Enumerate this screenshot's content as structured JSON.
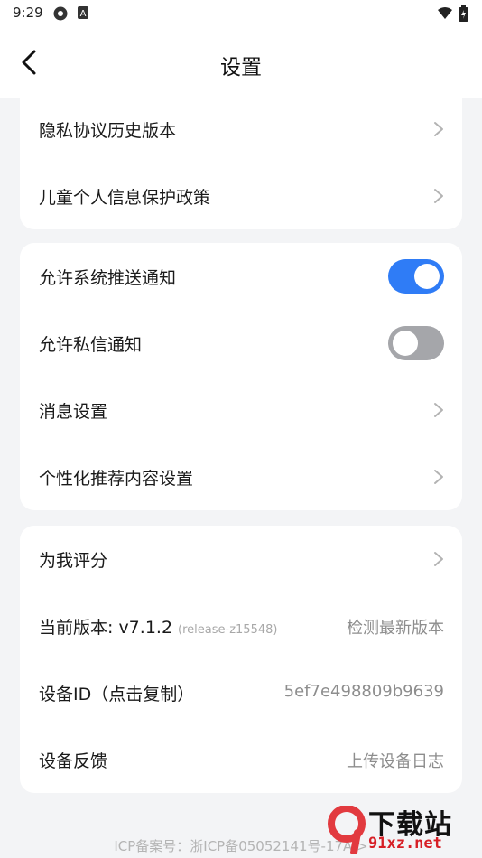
{
  "status_bar": {
    "time": "9:29"
  },
  "header": {
    "title": "设置"
  },
  "card1": {
    "items": [
      {
        "label": "隐私协议历史版本"
      },
      {
        "label": "儿童个人信息保护政策"
      }
    ]
  },
  "card2": {
    "push": {
      "label": "允许系统推送通知",
      "enabled": true
    },
    "dm": {
      "label": "允许私信通知",
      "enabled": false
    },
    "msg": {
      "label": "消息设置"
    },
    "rec": {
      "label": "个性化推荐内容设置"
    }
  },
  "card3": {
    "rate": {
      "label": "为我评分"
    },
    "version": {
      "label": "当前版本: v7.1.2",
      "build": "(release-z15548)",
      "action": "检测最新版本"
    },
    "device": {
      "label": "设备ID（点击复制）",
      "value": "5ef7e498809b9639"
    },
    "feedback": {
      "label": "设备反馈",
      "action": "上传设备日志"
    }
  },
  "footer": {
    "icp": "ICP备案号：浙ICP备05052141号-17A >"
  },
  "watermark": {
    "brand": "下载站",
    "url": "91xz.net"
  },
  "colors": {
    "accent": "#2f7cf6",
    "toggle_off": "#a5a6aa",
    "background": "#f3f4f6"
  }
}
